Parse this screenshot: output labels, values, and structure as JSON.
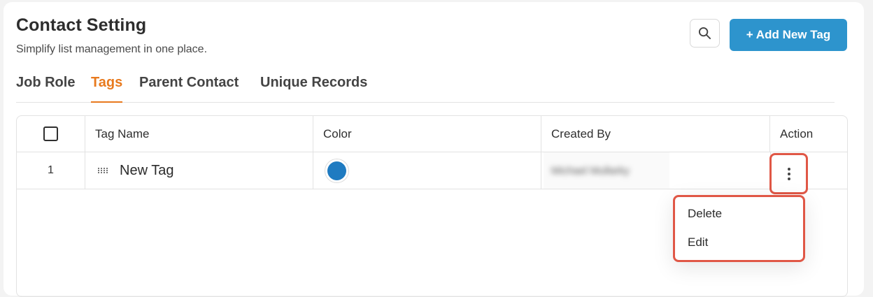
{
  "header": {
    "title": "Contact Setting",
    "subtitle": "Simplify list management in one place.",
    "search_icon": "search-icon",
    "add_button_label": "+ Add New Tag"
  },
  "tabs": [
    {
      "label": "Job Role",
      "active": false
    },
    {
      "label": "Tags",
      "active": true
    },
    {
      "label": "Parent Contact",
      "active": false
    },
    {
      "label": "Unique Records",
      "active": false
    }
  ],
  "table": {
    "columns": [
      "Tag Name",
      "Color",
      "Created By",
      "Action"
    ],
    "rows": [
      {
        "index": "1",
        "tag_name": "New Tag",
        "color": "#1f7bc1",
        "created_by": "Michael Mullarky"
      }
    ]
  },
  "row_menu": {
    "items": [
      "Delete",
      "Edit"
    ]
  },
  "colors": {
    "accent": "#e87a1e",
    "primary_button": "#2d94cd",
    "highlight_border": "#e05746"
  }
}
